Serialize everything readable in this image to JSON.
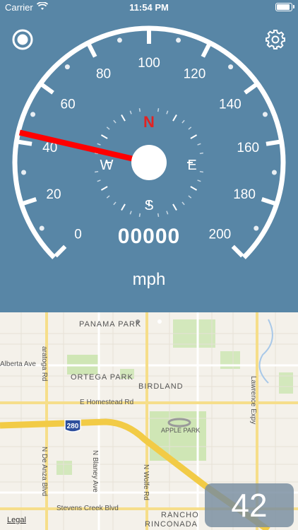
{
  "status_bar": {
    "carrier": "Carrier",
    "time": "11:54 PM",
    "battery_level": 1.0
  },
  "gauge": {
    "speed_labels": [
      "0",
      "20",
      "40",
      "60",
      "80",
      "100",
      "120",
      "140",
      "160",
      "180",
      "200"
    ],
    "compass": {
      "north": "N",
      "east": "E",
      "south": "S",
      "west": "W"
    },
    "odometer": "00000",
    "unit": "mph",
    "needle_value_mph": 43,
    "colors": {
      "background": "#5886A6",
      "needle": "#FF0000",
      "north": "#E22222",
      "ticks": "#FFFFFF"
    }
  },
  "map": {
    "labels": {
      "panama_park": "PANAMA PARK",
      "saratoga_rd": "aratoga Rd",
      "alberta_ave": "Alberta Ave",
      "ortega_park": "ORTEGA PARK",
      "birdland": "BIRDLAND",
      "lawrence_expy": "Lawrence Expy",
      "homestead_rd": "E Homestead Rd",
      "apple_park": "APPLE PARK",
      "de_anza_blvd": "N De Anza Blvd",
      "blaney_ave": "N Blaney Ave",
      "wolfe_rd": "N Wolfe Rd",
      "stevens_creek": "Stevens Creek Blvd",
      "rancho": "RANCHO",
      "rinconada": "RINCONADA",
      "highway_shield": "280"
    },
    "legal": "Legal"
  },
  "speed_display": {
    "value": "42"
  }
}
